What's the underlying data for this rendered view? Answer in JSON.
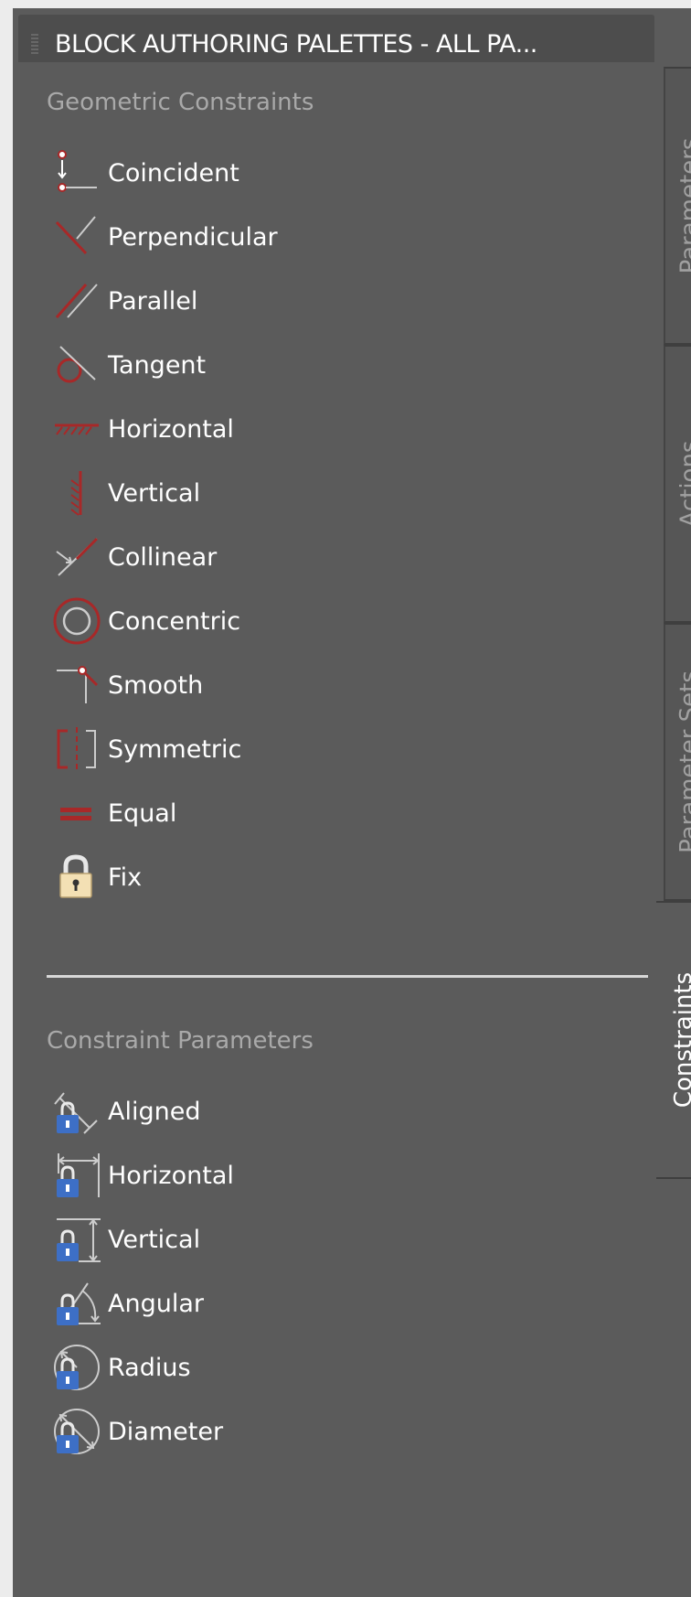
{
  "palette": {
    "title": "BLOCK AUTHORING PALETTES - ALL PA..."
  },
  "geometric": {
    "header": "Geometric Constraints",
    "items": [
      {
        "label": "Coincident",
        "icon": "coincident-icon"
      },
      {
        "label": "Perpendicular",
        "icon": "perpendicular-icon"
      },
      {
        "label": "Parallel",
        "icon": "parallel-icon"
      },
      {
        "label": "Tangent",
        "icon": "tangent-icon"
      },
      {
        "label": "Horizontal",
        "icon": "horizontal-constraint-icon"
      },
      {
        "label": "Vertical",
        "icon": "vertical-constraint-icon"
      },
      {
        "label": "Collinear",
        "icon": "collinear-icon"
      },
      {
        "label": "Concentric",
        "icon": "concentric-icon"
      },
      {
        "label": "Smooth",
        "icon": "smooth-icon"
      },
      {
        "label": "Symmetric",
        "icon": "symmetric-icon"
      },
      {
        "label": "Equal",
        "icon": "equal-icon"
      },
      {
        "label": "Fix",
        "icon": "lock-icon"
      }
    ]
  },
  "parameters": {
    "header": "Constraint Parameters",
    "items": [
      {
        "label": "Aligned",
        "icon": "aligned-dimension-icon"
      },
      {
        "label": "Horizontal",
        "icon": "horizontal-dimension-icon"
      },
      {
        "label": "Vertical",
        "icon": "vertical-dimension-icon"
      },
      {
        "label": "Angular",
        "icon": "angular-dimension-icon"
      },
      {
        "label": "Radius",
        "icon": "radius-dimension-icon"
      },
      {
        "label": "Diameter",
        "icon": "diameter-dimension-icon"
      }
    ]
  },
  "tabs": [
    {
      "label": "Parameters",
      "active": false
    },
    {
      "label": "Actions",
      "active": false
    },
    {
      "label": "Parameter Sets",
      "active": false
    },
    {
      "label": "Constraints",
      "active": true
    }
  ],
  "colors": {
    "constraint_red": "#a82828",
    "lock_blue": "#3d6fc6",
    "panel_bg": "#5b5b5b"
  }
}
